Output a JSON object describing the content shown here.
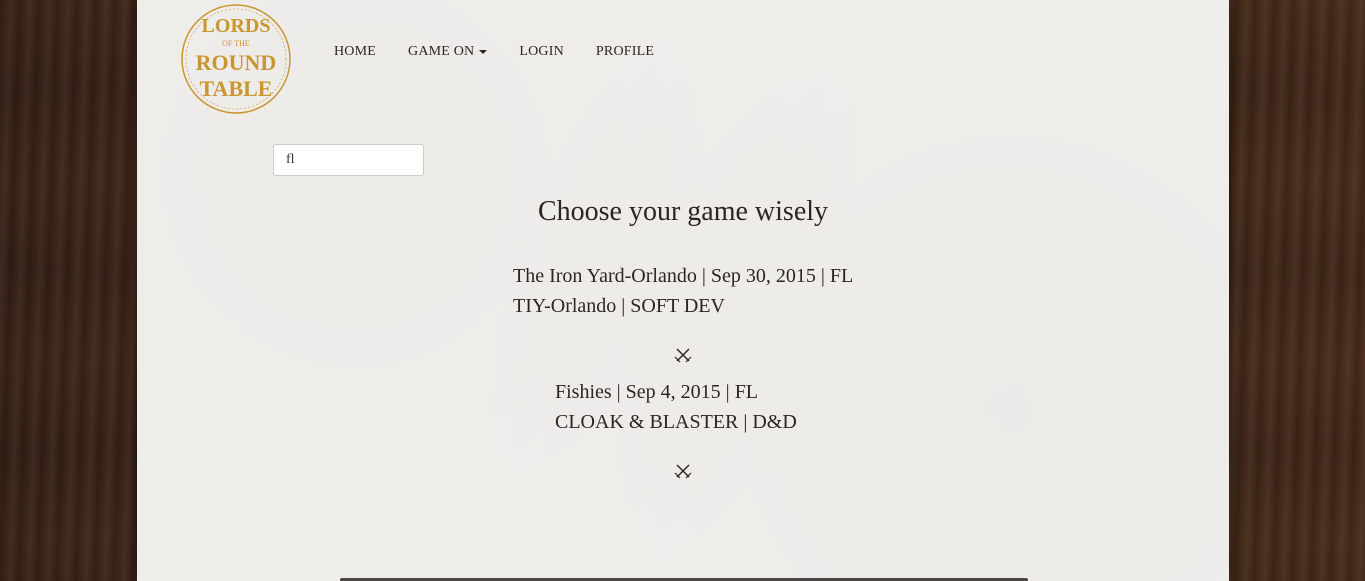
{
  "logo": {
    "lines": [
      "LORDS",
      "OF THE",
      "ROUND",
      "TABLE"
    ],
    "color": "#c9962f"
  },
  "nav": {
    "items": [
      {
        "label": "HOME"
      },
      {
        "label": "GAME ON"
      },
      {
        "label": "LOGIN"
      },
      {
        "label": "PROFILE"
      }
    ]
  },
  "search": {
    "value": "fl"
  },
  "page_title": "Choose your game wisely",
  "games": [
    {
      "line1": "The Iron Yard-Orlando | Sep 30, 2015 | FL",
      "line2": "TIY-Orlando | SOFT DEV"
    },
    {
      "line1": "Fishies | Sep 4, 2015 | FL",
      "line2": "CLOAK & BLASTER | D&D"
    }
  ],
  "divider_icon": "crossed-swords-icon",
  "colors": {
    "text": "#2f2520",
    "paper": "#f1efec",
    "wood": "#3a2418",
    "gold": "#c9962f"
  }
}
